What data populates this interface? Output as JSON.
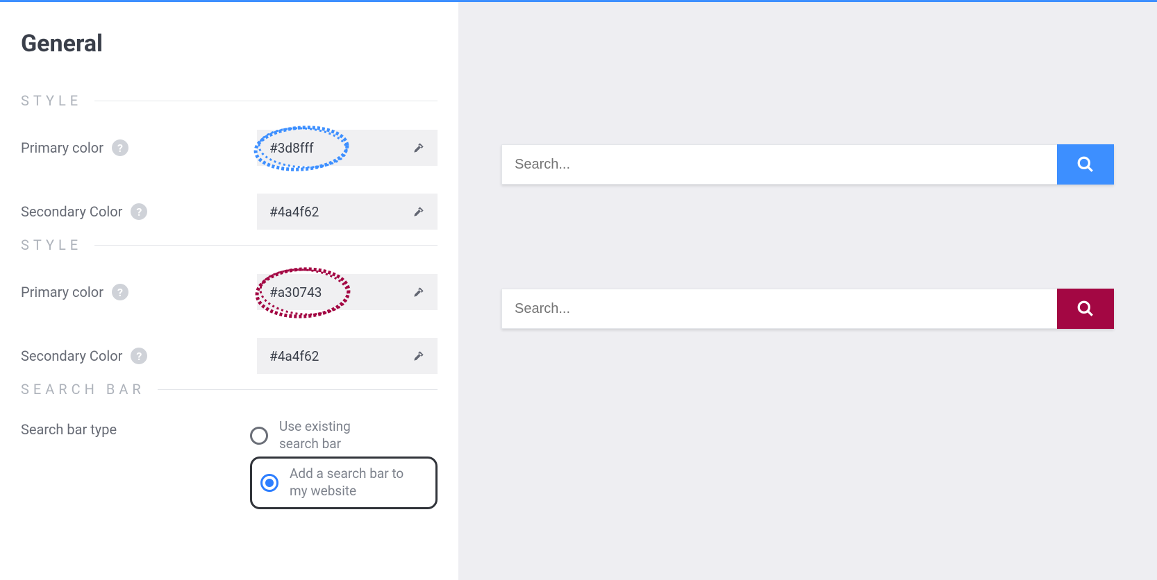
{
  "page": {
    "title": "General"
  },
  "sections": {
    "style1": {
      "header": "STYLE",
      "primary": {
        "label": "Primary color",
        "value": "#3d8fff",
        "circle_color": "#3d8fff"
      },
      "secondary": {
        "label": "Secondary Color",
        "value": "#4a4f62"
      }
    },
    "style2": {
      "header": "STYLE",
      "primary": {
        "label": "Primary color",
        "value": "#a30743",
        "circle_color": "#a30743"
      },
      "secondary": {
        "label": "Secondary Color",
        "value": "#4a4f62"
      }
    },
    "searchbar": {
      "header": "SEARCH BAR",
      "type_label": "Search bar type",
      "options": {
        "existing": "Use existing search bar",
        "add": "Add a search bar to my website"
      },
      "selected": "add"
    }
  },
  "preview": {
    "placeholder": "Search...",
    "btn1_color": "#3d8fff",
    "btn2_color": "#a30743"
  }
}
